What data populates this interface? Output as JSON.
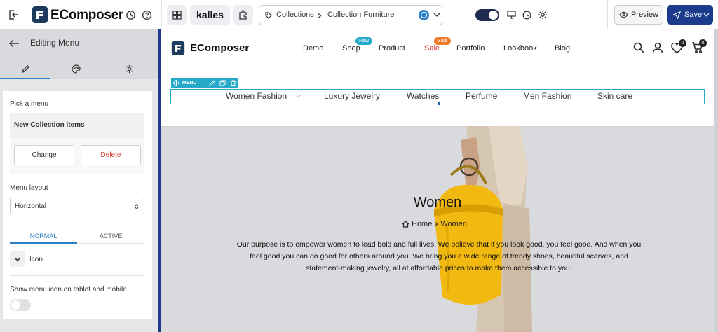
{
  "topbar": {
    "app_name": "EComposer",
    "theme_name": "kalles",
    "page_breadcrumb": {
      "section": "Collections",
      "page": "Collection Furniture"
    },
    "preview_label": "Preview",
    "save_label": "Save"
  },
  "sidebar": {
    "title": "Editing Menu",
    "tabs": [
      "pencil-icon",
      "palette-icon",
      "gear-icon"
    ],
    "pick_menu_label": "Pick a menu",
    "selected_menu": "New Collection items",
    "change_label": "Change",
    "delete_label": "Delete",
    "layout_label": "Menu layout",
    "layout_value": "Horizontal",
    "state_tabs": [
      "NORMAL",
      "ACTIVE"
    ],
    "icon_label": "Icon",
    "mobile_icon_label": "Show menu icon on tablet and mobile",
    "mobile_icon_enabled": false
  },
  "preview": {
    "logo_text": "EComposer",
    "nav": [
      "Demo",
      "Shop",
      "Product",
      "Sale",
      "Portfolio",
      "Lookbook",
      "Blog"
    ],
    "badges": {
      "shop": "New",
      "sale": "Sale"
    },
    "wishlist_count": "0",
    "cart_count": "0",
    "menu_tag": "MENU",
    "menu_items": [
      "Women Fashion",
      "Luxury Jewelry",
      "Watches",
      "Perfume",
      "Men Fashion",
      "Skin care"
    ],
    "hero": {
      "title": "Women",
      "breadcrumb_home": "Home",
      "breadcrumb_current": "Women",
      "description": "Our purpose is to empower women to lead bold and full lives. We believe that if you look good, you feel good. And when you feel good you can do good for others around you. We bring you a wide range of trendy shoes, beautiful scarves, and statement-making jewelry, all at affordable prices to make them accessible to you."
    }
  },
  "colors": {
    "accent": "#1c3d8c",
    "menu_outline": "#27a9c9",
    "delete_text": "#d9342b",
    "new_badge": "#27a9c9",
    "sale_badge": "#f07a2a",
    "sale_link": "#e0352b",
    "bag_yellow": "#f2b911"
  }
}
